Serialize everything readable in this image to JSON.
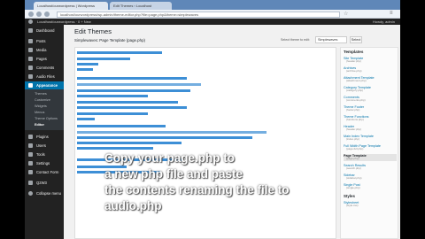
{
  "browser": {
    "tabs": [
      {
        "label": "Localhost/ourwordpress | Wordpress"
      },
      {
        "label": "Edit Themes ‹ Localhost"
      }
    ],
    "url": "localhost/ourwordpress/wp-admin/theme-editor.php?file=page.php&theme=simplewaves"
  },
  "admin_bar": {
    "site_name": "Localhost/ourwordpress · 0  + New",
    "howdy": "Howdy, admin"
  },
  "sidebar": {
    "items": [
      {
        "label": "Dashboard"
      },
      {
        "label": "Posts"
      },
      {
        "label": "Media"
      },
      {
        "label": "Pages"
      },
      {
        "label": "Comments"
      },
      {
        "label": "Audio Files"
      },
      {
        "label": "Appearance"
      },
      {
        "label": "Plugins"
      },
      {
        "label": "Users"
      },
      {
        "label": "Tools"
      },
      {
        "label": "Settings"
      },
      {
        "label": "Contact Form"
      },
      {
        "label": "Q2W3"
      },
      {
        "label": "Collapse menu"
      }
    ],
    "submenu": [
      {
        "label": "Themes"
      },
      {
        "label": "Customize"
      },
      {
        "label": "Widgets"
      },
      {
        "label": "Menus"
      },
      {
        "label": "Theme Options"
      },
      {
        "label": "Editor"
      }
    ]
  },
  "main": {
    "title": "Edit Themes",
    "file_heading": "Simplewaves: Page Template (page.php)",
    "select_label": "Select theme to edit:",
    "select_value": "Simplewaves",
    "select_button": "Select"
  },
  "templates_panel": {
    "heading": "Templates",
    "items": [
      {
        "name": "Site Template",
        "file": "(header.php)"
      },
      {
        "name": "Archives",
        "file": "(archive.php)"
      },
      {
        "name": "Attachment Template",
        "file": "(attachment.php)"
      },
      {
        "name": "Category Template",
        "file": "(category.php)"
      },
      {
        "name": "Comments",
        "file": "(comments.php)"
      },
      {
        "name": "Theme Footer",
        "file": "(footer.php)"
      },
      {
        "name": "Theme Functions",
        "file": "(functions.php)"
      },
      {
        "name": "Header",
        "file": "(header.php)"
      },
      {
        "name": "Main Index Template",
        "file": "(index.php)"
      },
      {
        "name": "Full Width Page Template",
        "file": "(page-full.php)"
      },
      {
        "name": "Page Template",
        "file": "(page.php)"
      },
      {
        "name": "Search Results",
        "file": "(search.php)"
      },
      {
        "name": "Sidebar",
        "file": "(sidebar.php)"
      },
      {
        "name": "Single Post",
        "file": "(single.php)"
      }
    ],
    "styles_heading": "Styles",
    "styles": [
      {
        "name": "Stylesheet",
        "file": "(style.css)"
      }
    ]
  },
  "overlay": {
    "caption": "Copy your page.php to\na new php file and paste\nthe contents renaming the file to\naudio.php"
  },
  "colors": {
    "sidebar_bg": "#222222",
    "active_blue": "#0073aa",
    "code_selection": "#3d8fd6"
  }
}
